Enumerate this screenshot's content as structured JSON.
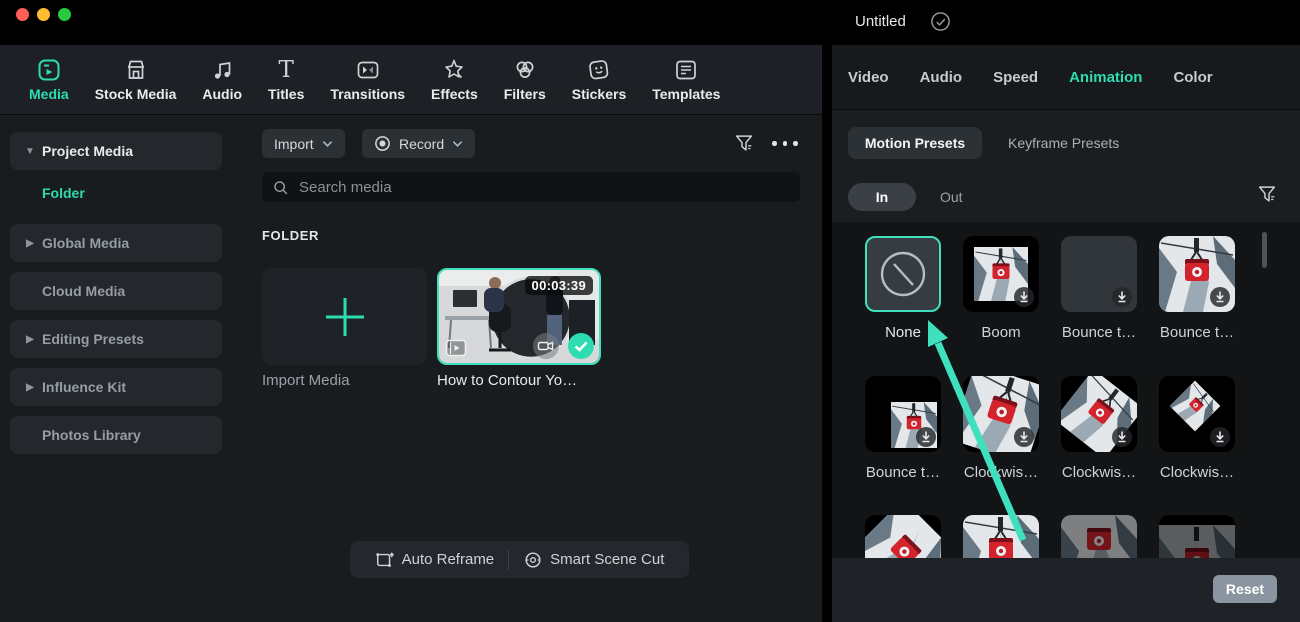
{
  "window": {
    "title": "Untitled"
  },
  "toolbar": {
    "tabs": [
      {
        "label": "Media",
        "active": true
      },
      {
        "label": "Stock Media"
      },
      {
        "label": "Audio"
      },
      {
        "label": "Titles"
      },
      {
        "label": "Transitions"
      },
      {
        "label": "Effects"
      },
      {
        "label": "Filters"
      },
      {
        "label": "Stickers"
      },
      {
        "label": "Templates"
      }
    ]
  },
  "sidebar": {
    "items": [
      {
        "label": "Project Media",
        "expanded": true
      },
      {
        "label": "Folder",
        "selected": true
      },
      {
        "label": "Global Media",
        "collapsed": true
      },
      {
        "label": "Cloud Media"
      },
      {
        "label": "Editing Presets",
        "collapsed": true
      },
      {
        "label": "Influence Kit",
        "collapsed": true
      },
      {
        "label": "Photos Library"
      }
    ]
  },
  "media_panel": {
    "import_button_label": "Import",
    "record_button_label": "Record",
    "search_placeholder": "Search media",
    "folder_section_label": "FOLDER",
    "import_tile_label": "Import Media",
    "video_item": {
      "title": "How to Contour Yo…",
      "duration": "00:03:39",
      "selected": true
    },
    "footer_actions": {
      "auto_reframe": "Auto Reframe",
      "smart_scene_cut": "Smart Scene Cut"
    }
  },
  "properties_panel": {
    "tabs": [
      {
        "label": "Video"
      },
      {
        "label": "Audio"
      },
      {
        "label": "Speed"
      },
      {
        "label": "Animation",
        "active": true
      },
      {
        "label": "Color"
      }
    ],
    "preset_tabs": [
      {
        "label": "Motion Presets",
        "active": true
      },
      {
        "label": "Keyframe Presets"
      }
    ],
    "direction_tabs": [
      {
        "label": "In",
        "active": true
      },
      {
        "label": "Out"
      }
    ],
    "preset_grid": {
      "row1": [
        {
          "label": "None",
          "selected": true
        },
        {
          "label": "Boom"
        },
        {
          "label": "Bounce t…"
        },
        {
          "label": "Bounce t…"
        }
      ],
      "row2": [
        {
          "label": "Bounce t…"
        },
        {
          "label": "Clockwis…"
        },
        {
          "label": "Clockwis…"
        },
        {
          "label": "Clockwis…"
        }
      ]
    },
    "reset_button_label": "Reset"
  },
  "colors": {
    "accent_teal": "#2EDCB2",
    "selection_border": "#3FE0BE",
    "arrow_annotation": "#3FE0BE",
    "reset_button_bg": "#8A95A1",
    "traffic_red": "#FF5F57",
    "traffic_yellow": "#FEBC2E",
    "traffic_green": "#27C93F"
  }
}
